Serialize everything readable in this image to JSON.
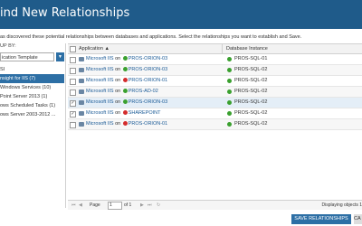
{
  "window": {
    "title": "ind New Relationships"
  },
  "description": "as discovered these potential relationships between databases and applications. Select the relationships you want to establish and Save.",
  "left_panel": {
    "group_by_label": "UP BY:",
    "group_select_value": "ication Template",
    "items": [
      {
        "label": "SI",
        "selected": false
      },
      {
        "label": "nsight for IIS (7)",
        "selected": true
      },
      {
        "label": "Windows Services (10)",
        "selected": false
      },
      {
        "label": "Point Server 2013 (1)",
        "selected": false
      },
      {
        "label": "ows Scheduled Tasks (1)",
        "selected": false
      },
      {
        "label": "ows Server 2003-2012 ...",
        "selected": false
      }
    ]
  },
  "grid": {
    "col_application": "Application",
    "col_database": "Database Instance",
    "rows": [
      {
        "checked": false,
        "app": "Microsoft IIS",
        "on": "on",
        "host": "PROS-ORION-03",
        "host_status": "green",
        "db": "PROS-SQL-01"
      },
      {
        "checked": false,
        "app": "Microsoft IIS",
        "on": "on",
        "host": "PROS-ORION-03",
        "host_status": "green",
        "db": "PROS-SQL-02"
      },
      {
        "checked": false,
        "app": "Microsoft IIS",
        "on": "on",
        "host": "PROS-ORION-01",
        "host_status": "red",
        "db": "PROS-SQL-02"
      },
      {
        "checked": false,
        "app": "Microsoft IIS",
        "on": "on",
        "host": "PROS-AD-02",
        "host_status": "green",
        "db": "PROS-SQL-02"
      },
      {
        "checked": true,
        "app": "Microsoft IIS",
        "on": "on",
        "host": "PROS-ORION-03",
        "host_status": "green",
        "db": "PROS-SQL-02"
      },
      {
        "checked": true,
        "app": "Microsoft IIS",
        "on": "on",
        "host": "SHAREPOINT",
        "host_status": "red",
        "db": "PROS-SQL-02"
      },
      {
        "checked": false,
        "app": "Microsoft IIS",
        "on": "on",
        "host": "PROS-ORION-01",
        "host_status": "red",
        "db": "PROS-SQL-02"
      }
    ],
    "pager": {
      "page_label": "Page",
      "page_value": "1",
      "of_label": "of 1",
      "displaying": "Displaying objects 1"
    }
  },
  "buttons": {
    "save": "SAVE RELATIONSHIPS",
    "cancel": "CA"
  },
  "colors": {
    "titlebar": "#1f5b8a",
    "accent": "#2d6fa5",
    "up": "#3aa02f",
    "down": "#d32c2c"
  }
}
